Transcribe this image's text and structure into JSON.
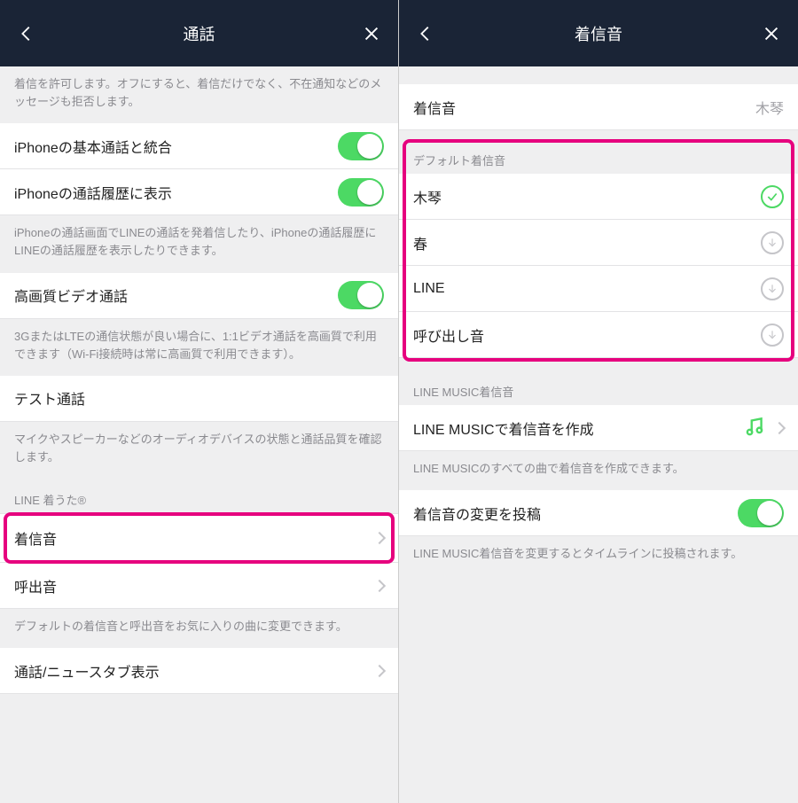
{
  "left": {
    "title": "通話",
    "note_top": "着信を許可します。オフにすると、着信だけでなく、不在通知などのメッセージも拒否します。",
    "rows": {
      "integrate_label": "iPhoneの基本通話と統合",
      "history_label": "iPhoneの通話履歴に表示"
    },
    "note_history": "iPhoneの通話画面でLINEの通話を発着信したり、iPhoneの通話履歴にLINEの通話履歴を表示したりできます。",
    "hq_label": "高画質ビデオ通話",
    "hq_note": "3GまたはLTEの通信状態が良い場合に、1:1ビデオ通話を高画質で利用できます（Wi-Fi接続時は常に高画質で利用できます）。",
    "test_label": "テスト通話",
    "test_note": "マイクやスピーカーなどのオーディオデバイスの状態と通話品質を確認します。",
    "line_uta_header": "LINE 着うた®",
    "ringtone_label": "着信音",
    "outgoing_label": "呼出音",
    "ring_note": "デフォルトの着信音と呼出音をお気に入りの曲に変更できます。",
    "newstab_label": "通話/ニュースタブ表示"
  },
  "right": {
    "title": "着信音",
    "current_label": "着信音",
    "current_value": "木琴",
    "default_header": "デフォルト着信音",
    "tones": {
      "0": "木琴",
      "1": "春",
      "2": "LINE",
      "3": "呼び出し音"
    },
    "music_header": "LINE MUSIC着信音",
    "music_row": "LINE MUSICで着信音を作成",
    "music_note": "LINE MUSICのすべての曲で着信音を作成できます。",
    "post_label": "着信音の変更を投稿",
    "post_note": "LINE MUSIC着信音を変更するとタイムラインに投稿されます。"
  }
}
